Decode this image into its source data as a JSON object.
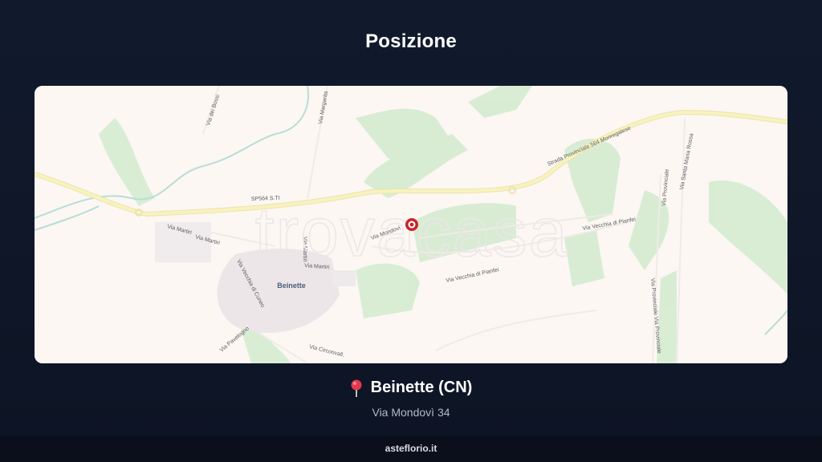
{
  "header": {
    "title": "Posizione"
  },
  "map": {
    "watermark": "trovacasa",
    "town_label": "Beinette",
    "streets": {
      "road_sp564": "SP564 S.TI",
      "provincial_564": "Strada Provinciale 564 Monregalese",
      "via_martiri_1": "Via Martiri",
      "via_martiri_2": "Via Martiri",
      "via_martiri_3": "Via Martiri",
      "via_martiri_4": "Via Martiri",
      "via_mondovi": "Via Mondovì",
      "via_vecchia_pianfei_1": "Via Vecchia di Pianfei",
      "via_vecchia_pianfei_2": "Via Vecchia di Pianfei",
      "via_vecchia_cuneo": "Via Vecchia di Cuneo",
      "via_pavelogno": "Via Pavelogno",
      "via_circonvallazione": "Via Circonvall.",
      "via_margarita": "Via Margarita",
      "via_dei_bossi": "Via dei Bossi",
      "via_provinciale": "Via Provinciale",
      "via_santa_maria": "Via Santa Maria Rossa",
      "via_provinciale_sud": "Via Provinciale Via Provinciale"
    },
    "marker_icon": "location-marker-icon",
    "colors": {
      "marker": "#c8232c",
      "road": "#f6f0a8",
      "green": "#d3ead0"
    }
  },
  "location": {
    "icon": "pin-icon",
    "title": "Beinette (CN)",
    "address": "Via Mondovì 34"
  },
  "footer": {
    "site": "asteflorio.it"
  }
}
